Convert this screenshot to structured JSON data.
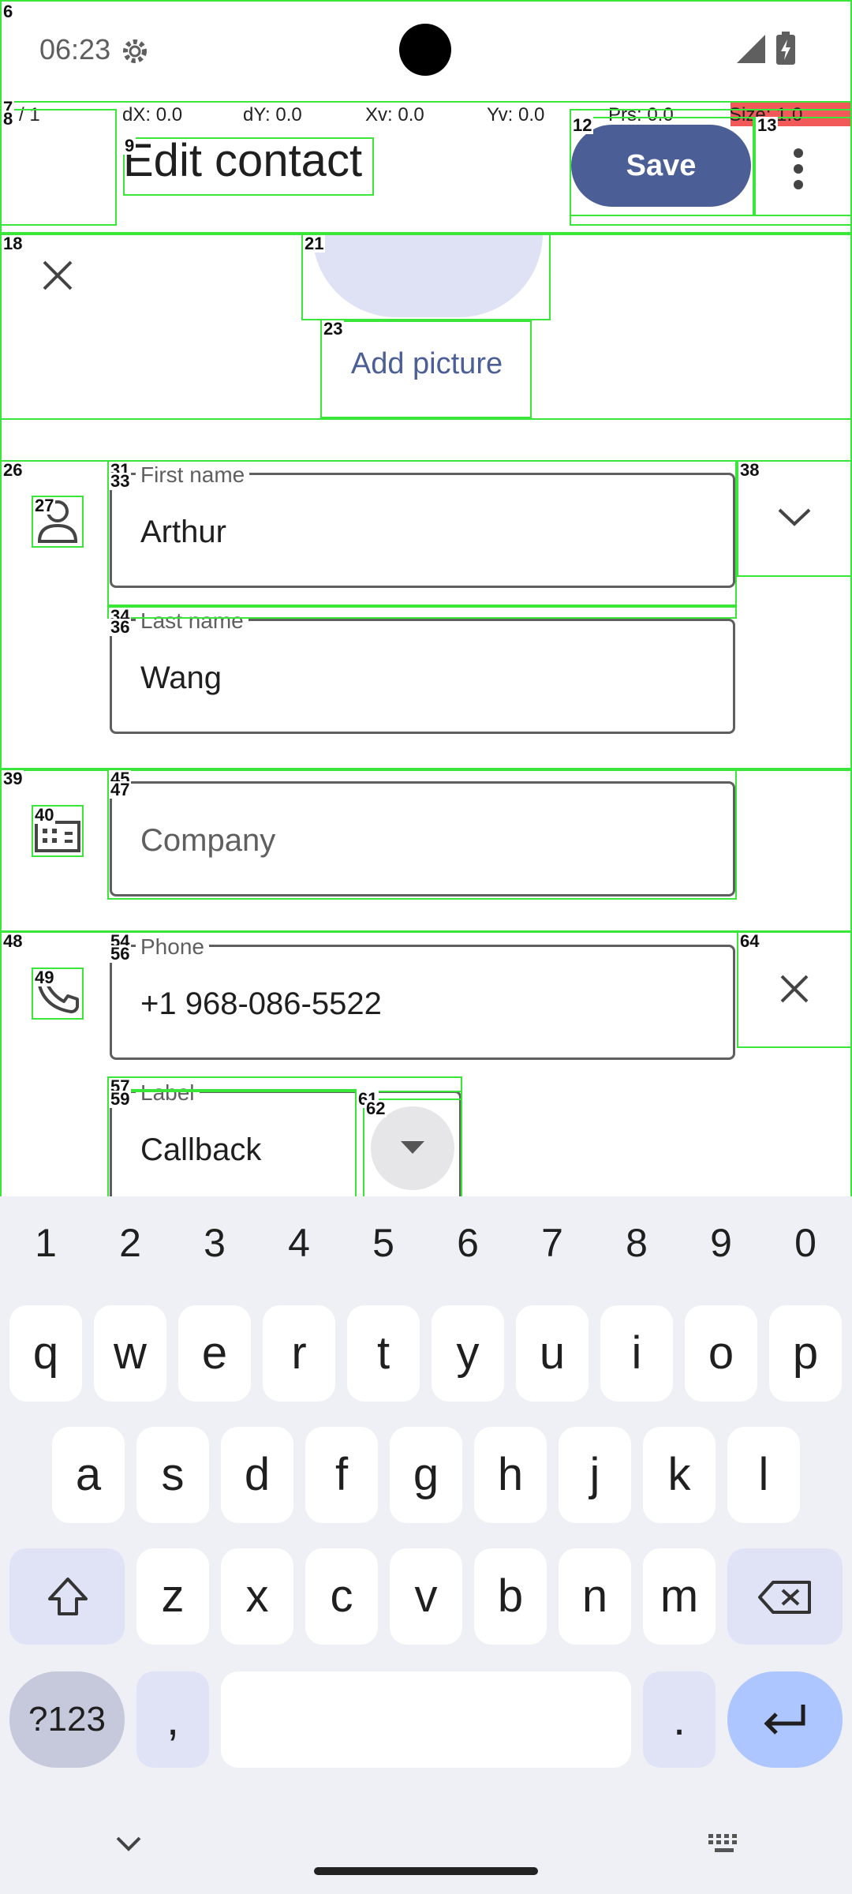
{
  "status_bar": {
    "time": "06:23"
  },
  "pointer_bar": {
    "pointer": "0 / 1",
    "dx": "dX: 0.0",
    "dy": "dY: 0.0",
    "xv": "Xv: 0.0",
    "yv": "Yv: 0.0",
    "prs": "Prs: 0.0",
    "size": "Size: 1.0"
  },
  "app_bar": {
    "title": "Edit contact",
    "save_label": "Save"
  },
  "photo": {
    "add_picture_label": "Add picture"
  },
  "form": {
    "first_name": {
      "label": "First name",
      "value": "Arthur"
    },
    "last_name": {
      "label": "Last name",
      "value": "Wang"
    },
    "company": {
      "placeholder": "Company"
    },
    "phone": {
      "label": "Phone",
      "value": "+1 968-086-5522"
    },
    "phone_label": {
      "label": "Label",
      "value": "Callback"
    }
  },
  "keyboard": {
    "number_row": [
      "1",
      "2",
      "3",
      "4",
      "5",
      "6",
      "7",
      "8",
      "9",
      "0"
    ],
    "row1": [
      "q",
      "w",
      "e",
      "r",
      "t",
      "y",
      "u",
      "i",
      "o",
      "p"
    ],
    "row2": [
      "a",
      "s",
      "d",
      "f",
      "g",
      "h",
      "j",
      "k",
      "l"
    ],
    "row3": [
      "z",
      "x",
      "c",
      "v",
      "b",
      "n",
      "m"
    ],
    "symbols_key": "?123",
    "comma": ",",
    "period": "."
  },
  "overlay_numbers": [
    "6",
    "7",
    "8",
    "9",
    "12",
    "13",
    "18",
    "21",
    "23",
    "26",
    "27",
    "31",
    "33",
    "34",
    "36",
    "38",
    "39",
    "40",
    "45",
    "47",
    "48",
    "49",
    "54",
    "56",
    "57",
    "59",
    "61",
    "62",
    "64"
  ],
  "colors": {
    "accent": "#4b5e96",
    "avatar_bg": "#dfe2f5",
    "debug_box": "#39e639",
    "enter_key": "#adc6ff"
  }
}
